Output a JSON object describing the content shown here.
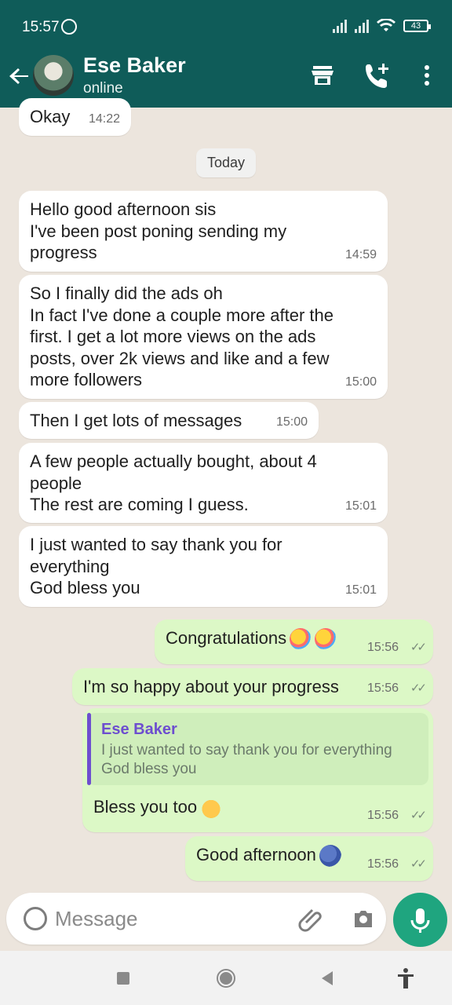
{
  "status": {
    "time": "15:57",
    "battery": "43",
    "icons": [
      "whatsapp-icon",
      "signal-icon",
      "signal-icon",
      "wifi-icon",
      "battery-icon"
    ]
  },
  "header": {
    "contact_name": "Ese Baker",
    "contact_status": "online",
    "icons": [
      "back-arrow-icon",
      "store-icon",
      "add-call-icon",
      "more-vertical-icon"
    ]
  },
  "day_label": "Today",
  "messages": [
    {
      "dir": "in",
      "text": "Okay",
      "time": "14:22"
    },
    {
      "dir": "in",
      "text": "Hello good afternoon sis\nI've been post poning sending my\nprogress",
      "time": "14:59"
    },
    {
      "dir": "in",
      "text": "So I finally did the ads oh\nIn fact I've done a couple more after the\nfirst. I get a lot more views on the ads\nposts, over 2k views and like and a few\nmore followers",
      "time": "15:00"
    },
    {
      "dir": "in",
      "text": "Then I get lots of messages",
      "time": "15:00"
    },
    {
      "dir": "in",
      "text": "A few people actually bought, about 4\npeople\nThe rest are coming I guess.",
      "time": "15:01"
    },
    {
      "dir": "in",
      "text": "I just wanted to say thank you for\neverything\nGod bless you",
      "time": "15:01"
    },
    {
      "dir": "out",
      "text": "Congratulations",
      "emoji": "party-popper-emoji",
      "time": "15:56"
    },
    {
      "dir": "out",
      "text": "I'm so happy about your progress",
      "time": "15:56"
    },
    {
      "dir": "out",
      "quote": {
        "name": "Ese Baker",
        "text": "I just wanted to say thank you for everything\nGod bless you"
      },
      "text": "Bless you too",
      "emoji": "folded-hands-emoji",
      "time": "15:56"
    },
    {
      "dir": "out",
      "text": "Good afternoon",
      "emoji": "people-hugging-emoji",
      "time": "15:56"
    }
  ],
  "composer": {
    "placeholder": "Message",
    "icons": [
      "emoji-icon",
      "attach-icon",
      "camera-icon",
      "mic-icon"
    ]
  },
  "navbar": {
    "icons": [
      "recents-icon",
      "home-icon",
      "back-icon",
      "accessibility-icon"
    ]
  },
  "colors": {
    "header": "#0f5c59",
    "outgoing_bubble": "#dcf8c6",
    "incoming_bubble": "#ffffff",
    "chat_bg": "#ece5dd",
    "quote_accent": "#6d4ecf",
    "mic": "#1fa57f"
  }
}
